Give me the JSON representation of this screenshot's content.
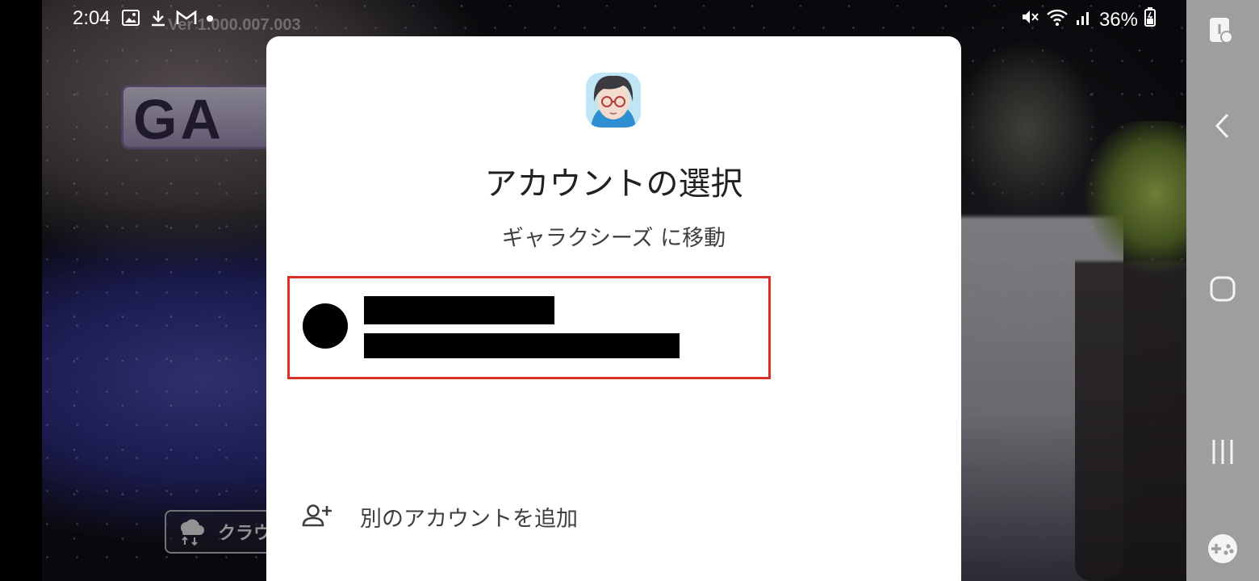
{
  "status_bar": {
    "time": "2:04",
    "battery": "36%",
    "icons_left": [
      "image-icon",
      "download-icon",
      "gmail-icon",
      "dot-icon"
    ],
    "icons_right": [
      "mute-icon",
      "wifi-icon",
      "signal-icon",
      "battery-charging-icon"
    ]
  },
  "game": {
    "version": "Ver 1.000.007.003",
    "logo_text": "GA",
    "cloud_button_label": "クラウ"
  },
  "dialog": {
    "title": "アカウントの選択",
    "subtitle": "ギャラクシーズ に移動",
    "add_account_label": "別のアカウントを追加"
  },
  "colors": {
    "highlight_border": "#d93025",
    "dialog_bg": "#ffffff",
    "nav_bar_bg": "#9e9e9e"
  }
}
